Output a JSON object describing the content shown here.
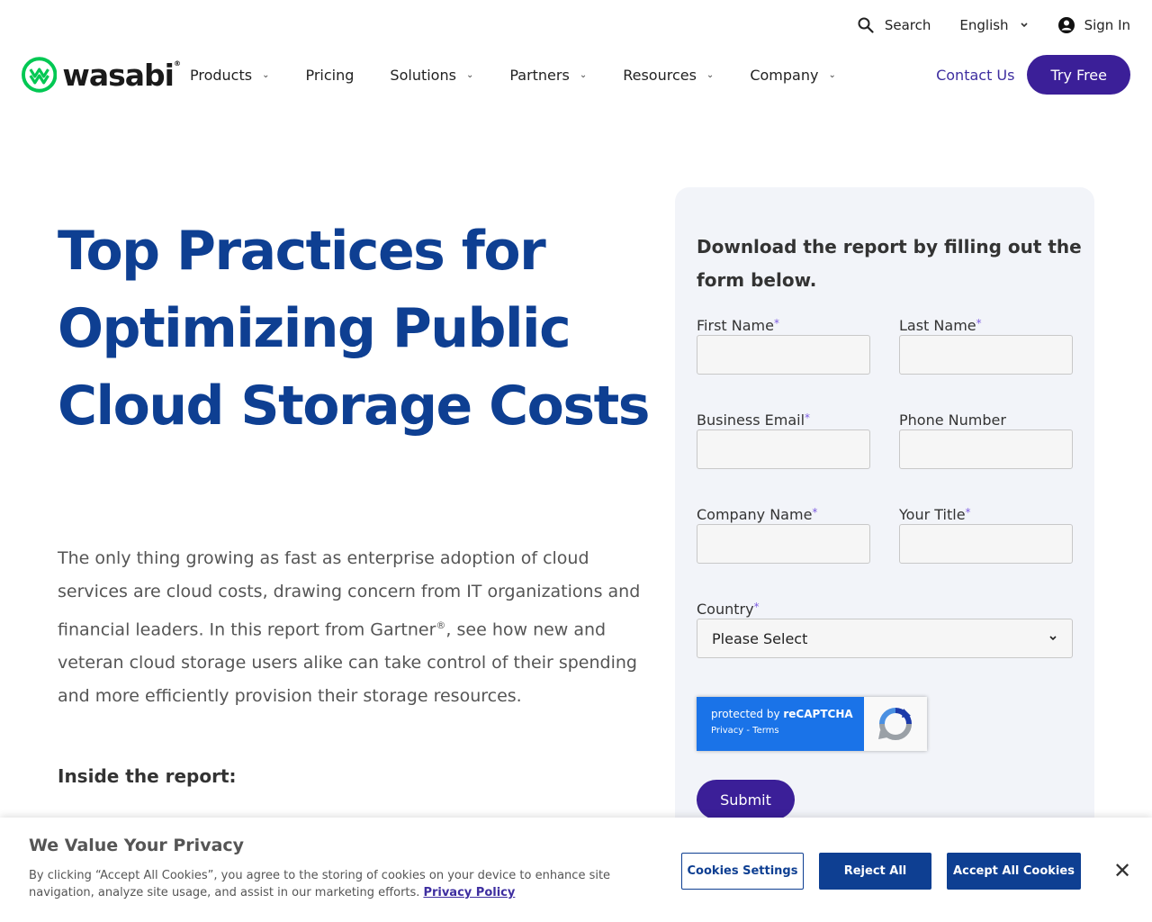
{
  "utility": {
    "search_label": "Search",
    "language_label": "English",
    "signin_label": "Sign In"
  },
  "logo": {
    "text": "wasabi",
    "mark": "®"
  },
  "nav": {
    "items": [
      {
        "label": "Products",
        "has_dropdown": true
      },
      {
        "label": "Pricing",
        "has_dropdown": false
      },
      {
        "label": "Solutions",
        "has_dropdown": true
      },
      {
        "label": "Partners",
        "has_dropdown": true
      },
      {
        "label": "Resources",
        "has_dropdown": true
      },
      {
        "label": "Company",
        "has_dropdown": true
      }
    ],
    "contact_label": "Contact Us",
    "try_free_label": "Try Free"
  },
  "hero": {
    "title": "Top Practices for Optimizing Public Cloud Storage Costs",
    "body_part1": "The only thing growing as fast as enterprise adoption of cloud services are cloud costs, drawing concern from IT organizations and financial leaders. In this report from Gartner",
    "body_reg": "®",
    "body_part2": ", see how new and veteran cloud storage users alike can take control of their spending and more efficiently provision their storage resources.",
    "inside_heading": "Inside the report:"
  },
  "form": {
    "heading": "Download the report by filling out the form below.",
    "required_mark": "*",
    "first_name_label": "First Name",
    "last_name_label": "Last Name",
    "business_email_label": "Business Email",
    "phone_label": "Phone Number",
    "company_label": "Company Name",
    "title_label": "Your Title",
    "country_label": "Country",
    "country_value": "Please Select",
    "submit_label": "Submit"
  },
  "recaptcha": {
    "line1_prefix": "protected by ",
    "line1_brand": "reCAPTCHA",
    "line2": "Privacy - Terms"
  },
  "cookie": {
    "title": "We Value Your Privacy",
    "text": "By clicking “Accept All Cookies”, you agree to the storing of cookies on your device to enhance site navigation, analyze site usage, and assist in our marketing efforts.",
    "policy_link": "Privacy Policy",
    "settings_label": "Cookies Settings",
    "reject_label": "Reject All",
    "accept_label": "Accept All Cookies",
    "close_glyph": "✕"
  },
  "colors": {
    "brand_purple": "#3b1f98",
    "heading_blue": "#0e3f92",
    "logo_green": "#00c853",
    "form_bg": "#f2f4f9"
  }
}
